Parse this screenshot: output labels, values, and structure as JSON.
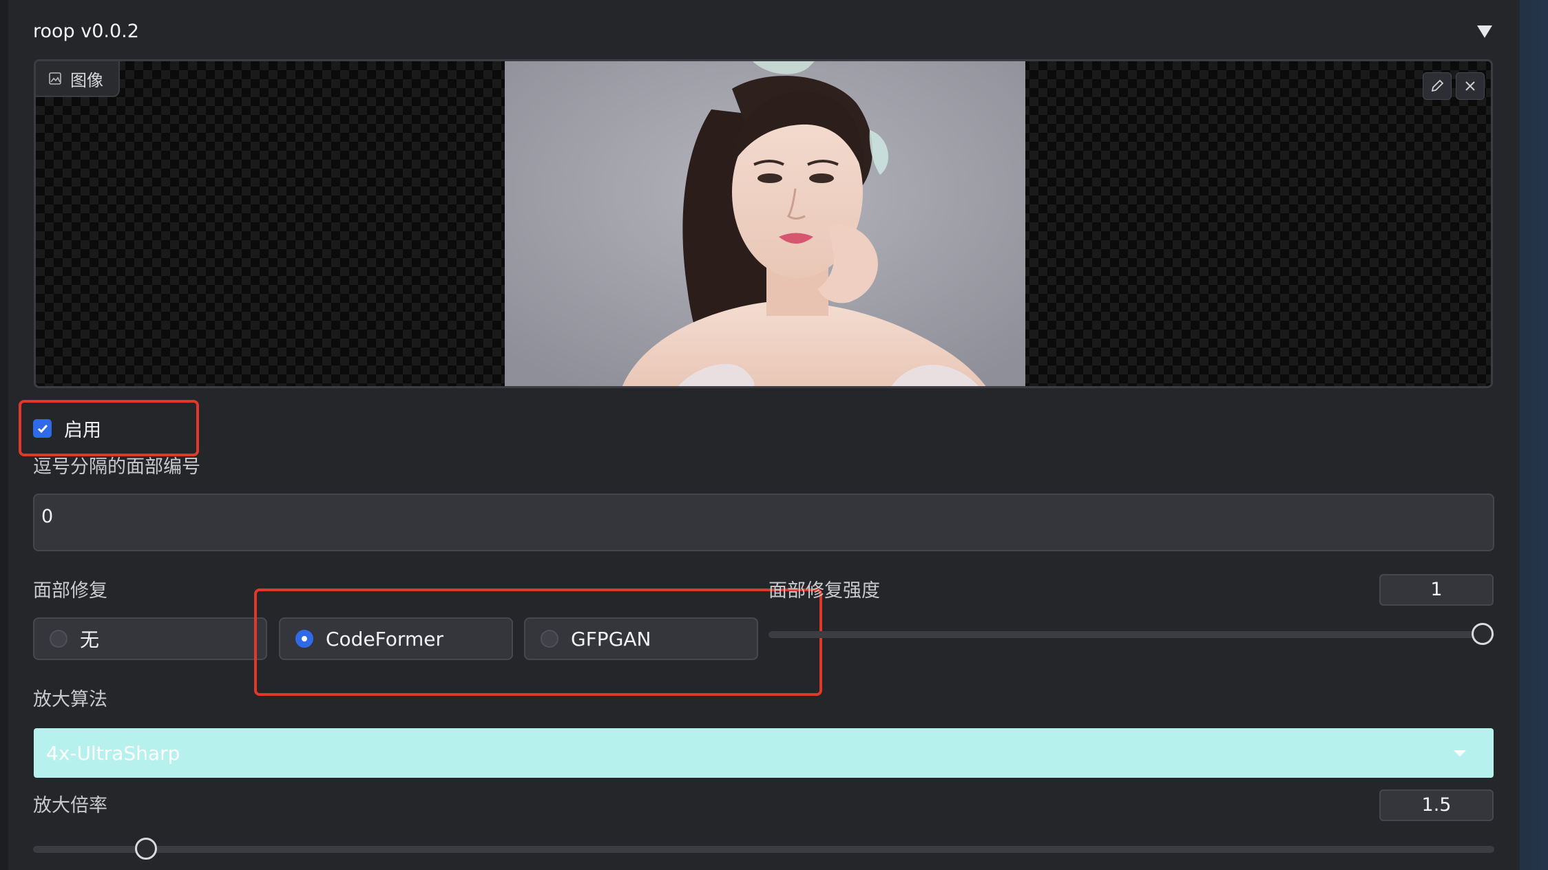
{
  "header": {
    "title": "roop v0.0.2"
  },
  "image": {
    "label": "图像",
    "edit_icon": "pencil-icon",
    "close_icon": "close-icon"
  },
  "enable": {
    "label": "启用",
    "checked": true
  },
  "face_index": {
    "label": "逗号分隔的面部编号",
    "value": "0"
  },
  "face_restore": {
    "label": "面部修复",
    "options": [
      "无",
      "CodeFormer",
      "GFPGAN"
    ],
    "selected": "CodeFormer"
  },
  "restore_strength": {
    "label": "面部修复强度",
    "value": "1",
    "level": 1.0
  },
  "upscaler": {
    "label": "放大算法",
    "selected": "4x-UltraSharp"
  },
  "upscale_ratio": {
    "label": "放大倍率",
    "value": "1.5",
    "level": 0.08
  },
  "colors": {
    "accent": "#2f6be8",
    "highlight": "#e0382a",
    "dropdown_bg": "#b6f1ee"
  }
}
